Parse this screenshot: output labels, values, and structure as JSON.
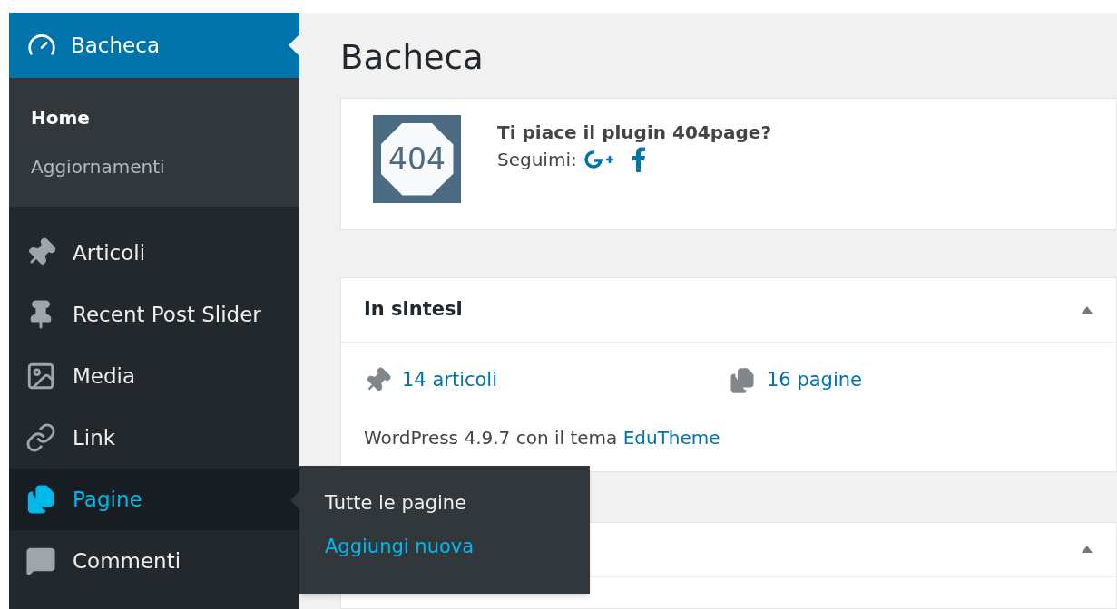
{
  "sidebar": {
    "header": {
      "label": "Bacheca",
      "selected": true
    },
    "submenu": [
      {
        "label": "Home",
        "selected": true
      },
      {
        "label": "Aggiornamenti",
        "selected": false
      }
    ],
    "items": [
      {
        "label": "Articoli",
        "kind": "pin",
        "hovered": false
      },
      {
        "label": "Recent Post Slider",
        "kind": "pushpin",
        "hovered": false
      },
      {
        "label": "Media",
        "kind": "media",
        "hovered": false
      },
      {
        "label": "Link",
        "kind": "link",
        "hovered": false
      },
      {
        "label": "Pagine",
        "kind": "pages",
        "hovered": true,
        "flyout": [
          {
            "label": "Tutte le pagine",
            "hovered": false
          },
          {
            "label": "Aggiungi nuova",
            "hovered": true
          }
        ]
      },
      {
        "label": "Commenti",
        "kind": "comments",
        "hovered": false
      }
    ]
  },
  "page_title": "Bacheca",
  "plugin_notice": {
    "logo": "404",
    "question": "Ti piace il plugin 404page?",
    "follow_label": "Seguimi:"
  },
  "at_a_glance": {
    "title": "In sintesi",
    "expanded": true,
    "stats": [
      {
        "kind": "pin",
        "label": "14 articoli"
      },
      {
        "kind": "pages",
        "label": "16 pagine"
      }
    ],
    "version_text": "WordPress 4.9.7 con il tema",
    "theme_link": "EduTheme"
  },
  "second_panel": {
    "expanded": true
  }
}
